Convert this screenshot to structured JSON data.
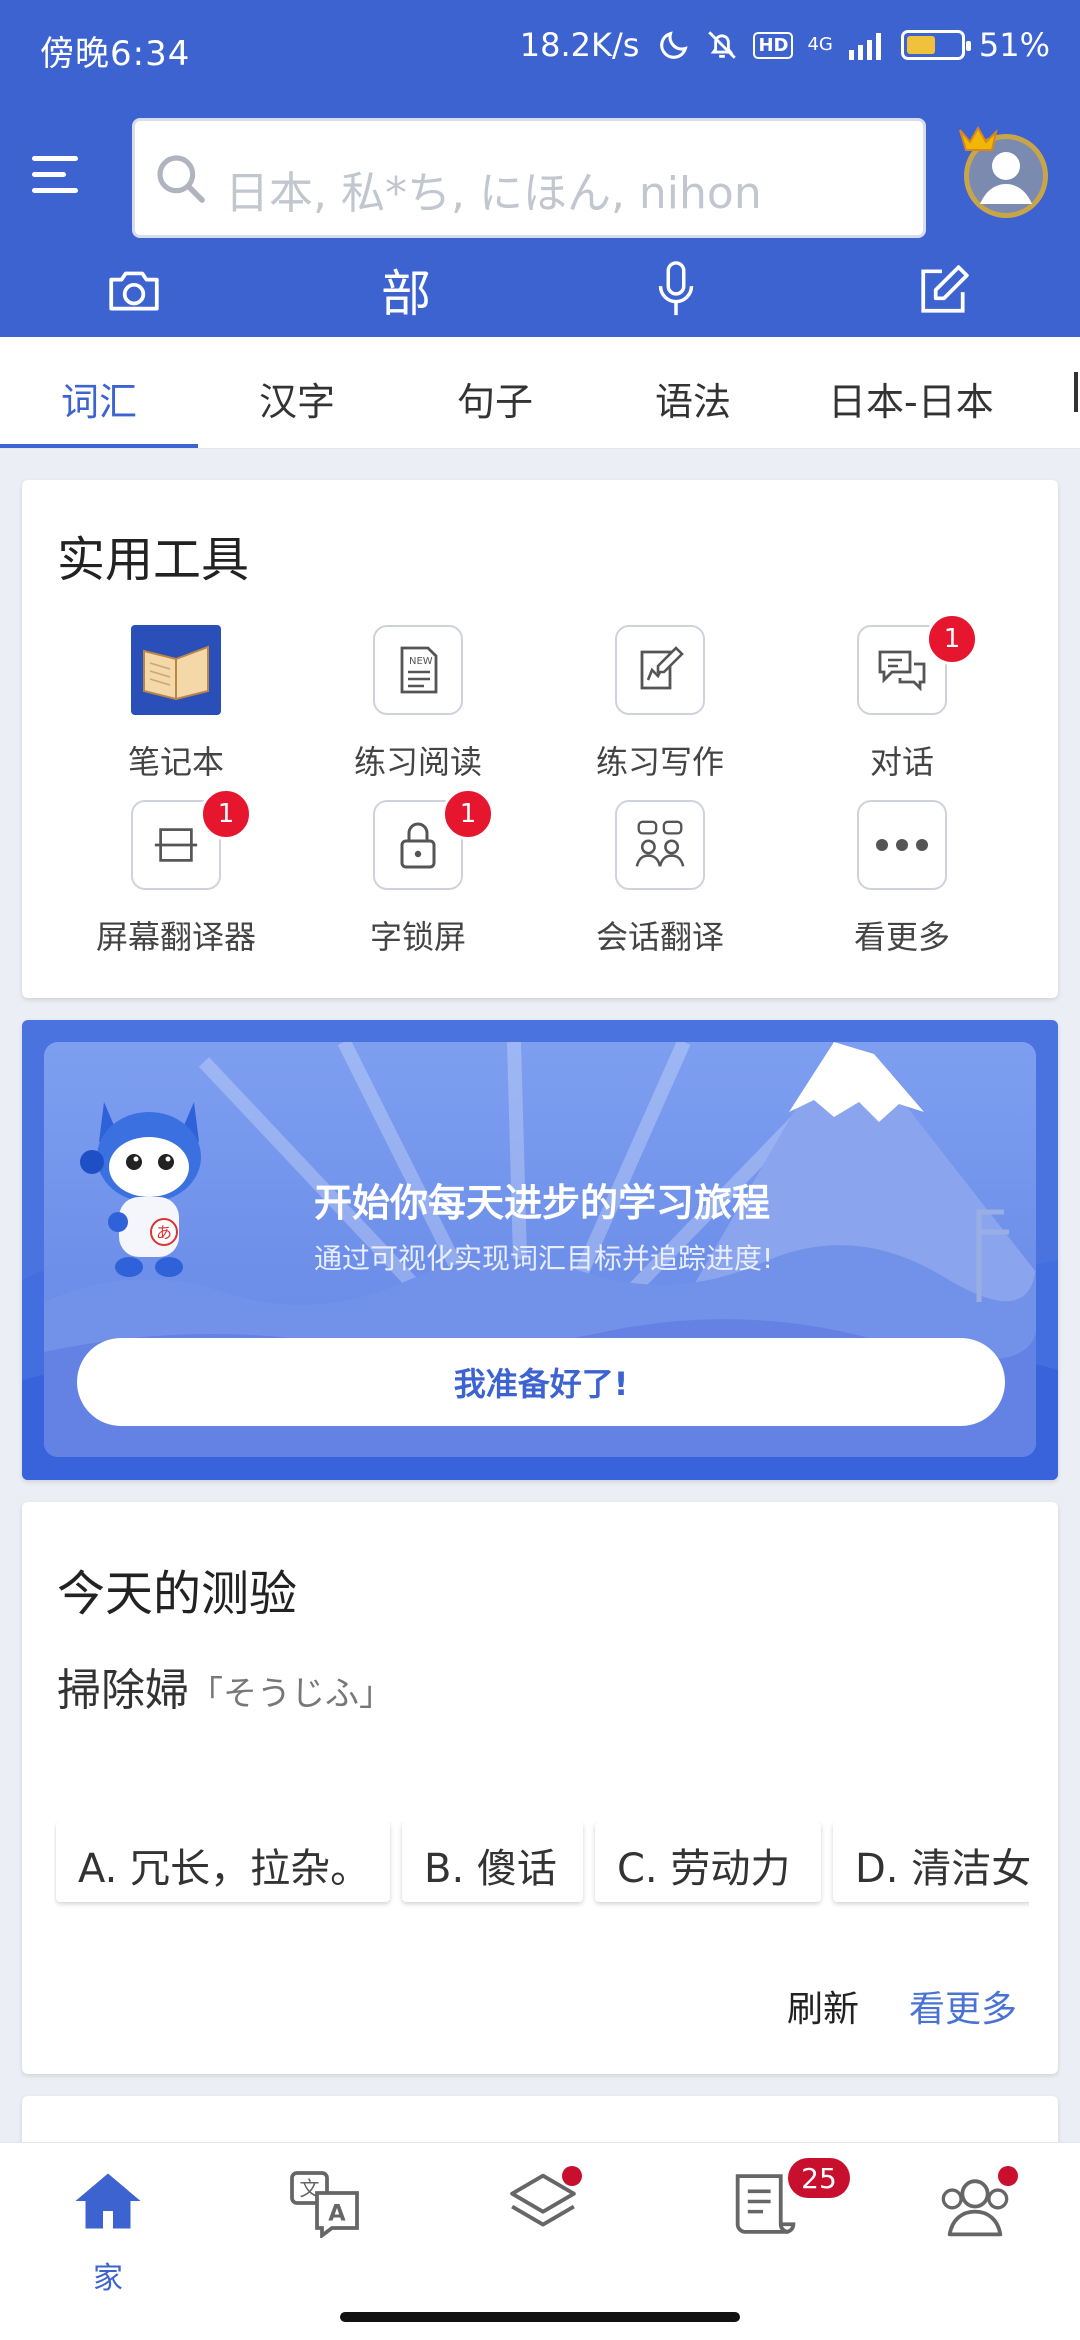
{
  "status": {
    "time": "傍晚6:34",
    "net_speed": "18.2K/s",
    "hd": "HD",
    "network": "4G",
    "battery": "51%",
    "battery_level": 0.51
  },
  "search": {
    "placeholder": "日本, 私*ち, にほん, nihon"
  },
  "tools_row": {
    "radical_label": "部"
  },
  "tabs": [
    {
      "label": "词汇",
      "active": true
    },
    {
      "label": "汉字"
    },
    {
      "label": "句子"
    },
    {
      "label": "语法"
    },
    {
      "label": "日本-日本"
    }
  ],
  "tools": {
    "title": "实用工具",
    "items": [
      {
        "label": "笔记本",
        "icon": "notebook-icon"
      },
      {
        "label": "练习阅读",
        "icon": "reading-icon",
        "badge_text": "NEW"
      },
      {
        "label": "练习写作",
        "icon": "writing-icon"
      },
      {
        "label": "对话",
        "icon": "chat-icon",
        "badge": "1"
      },
      {
        "label": "屏幕翻译器",
        "icon": "screen-translate-icon",
        "badge": "1"
      },
      {
        "label": "字锁屏",
        "icon": "lock-icon",
        "badge": "1"
      },
      {
        "label": "会话翻译",
        "icon": "conversation-icon"
      },
      {
        "label": "看更多",
        "icon": "more-icon"
      }
    ]
  },
  "banner": {
    "title": "开始你每天进步的学习旅程",
    "subtitle": "通过可视化实现词汇目标并追踪进度!",
    "button": "我准备好了!",
    "mascot_letter": "あ"
  },
  "quiz": {
    "title": "今天的测验",
    "word": "掃除婦",
    "reading": "「そうじふ」",
    "options": [
      "A. 冗长，拉杂。",
      "B. 傻话",
      "C. 劳动力",
      "D. 清洁女"
    ],
    "refresh": "刷新",
    "see_more": "看更多"
  },
  "bottom_nav": {
    "home_label": "家",
    "news_badge": "25",
    "translate_glyph_top": "文",
    "translate_glyph_bottom": "A",
    "accent": "#3d63d1",
    "badge_color": "#c8102e"
  }
}
